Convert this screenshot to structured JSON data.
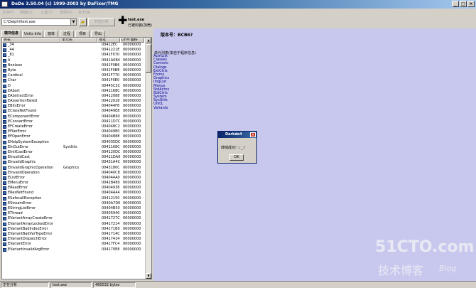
{
  "window": {
    "title": "DeDe 3.50.04 (c) 1999-2003 by DaFixer/TMG"
  },
  "titlebar_buttons": [
    "_",
    "□",
    "×"
  ],
  "menu": [
    "文件(F)",
    "转储(D)",
    "工具(T)",
    "选项(O)",
    "关于(A)"
  ],
  "toolbar": {
    "file_path": "C:\\Delphi\\test.exe",
    "combo_arrow": "▼",
    "open_icon": "folder-icon",
    "start_button": "开始分析",
    "file_name": "test.exe",
    "file_subtitle": "已被封装(加壳)"
  },
  "tabs": [
    "模块信息",
    "Units Info",
    "窗体",
    "过程",
    "项目",
    "导出"
  ],
  "columns": [
    "类名",
    "单元名",
    "地址",
    "DFM 偏移"
  ],
  "rows": [
    {
      "name": "_34",
      "unit": "",
      "addr": "00412EC",
      "dfm": "00000000"
    },
    {
      "name": "_44",
      "unit": "",
      "addr": "0041221E",
      "dfm": "00000000"
    },
    {
      "name": "_81",
      "unit": "",
      "addr": "0041F070",
      "dfm": "00000000"
    },
    {
      "name": "A",
      "unit": "",
      "addr": "0041A0B4",
      "dfm": "00000000"
    },
    {
      "name": "Boolean",
      "unit": "",
      "addr": "0041F0B6",
      "dfm": "00000000"
    },
    {
      "name": "Byte",
      "unit": "",
      "addr": "0041F0BE",
      "dfm": "00000000"
    },
    {
      "name": "Cardinal",
      "unit": "",
      "addr": "0041F770",
      "dfm": "00000000"
    },
    {
      "name": "Char",
      "unit": "",
      "addr": "0041F0E0",
      "dfm": "00000000"
    },
    {
      "name": "D",
      "unit": "",
      "addr": "00445C3C",
      "dfm": "00000000"
    },
    {
      "name": "EAbort",
      "unit": "",
      "addr": "0041168C",
      "dfm": "00000000"
    },
    {
      "name": "EAbstractError",
      "unit": "",
      "addr": "00412088",
      "dfm": "00000000"
    },
    {
      "name": "EAssertionFailed",
      "unit": "",
      "addr": "00412028",
      "dfm": "00000000"
    },
    {
      "name": "EBitsError",
      "unit": "",
      "addr": "004044F8",
      "dfm": "00000000"
    },
    {
      "name": "EClassNotFound",
      "unit": "",
      "addr": "004049E8",
      "dfm": "00000000"
    },
    {
      "name": "EComponentError",
      "unit": "",
      "addr": "00404B60",
      "dfm": "00000000"
    },
    {
      "name": "EConvertError",
      "unit": "",
      "addr": "00411D7C",
      "dfm": "00000000"
    },
    {
      "name": "EFCreateError",
      "unit": "",
      "addr": "004048C2",
      "dfm": "00000000"
    },
    {
      "name": "EFilerError",
      "unit": "",
      "addr": "004049E0",
      "dfm": "00000000"
    },
    {
      "name": "EFOpenError",
      "unit": "",
      "addr": "00404888",
      "dfm": "00000000"
    },
    {
      "name": "EHelpSystemException",
      "unit": "",
      "addr": "004035DC",
      "dfm": "00000000"
    },
    {
      "name": "EInOutError",
      "unit": "SysUtils",
      "addr": "0041168C",
      "dfm": "00000000"
    },
    {
      "name": "EIntfCastError",
      "unit": "",
      "addr": "004120DC",
      "dfm": "00000000"
    },
    {
      "name": "EInvalidCast",
      "unit": "",
      "addr": "00411DA0",
      "dfm": "00000000"
    },
    {
      "name": "EInvalidGraphic",
      "unit": "",
      "addr": "00431A4C",
      "dfm": "00000000"
    },
    {
      "name": "EInvalidGraphicOperation",
      "unit": "Graphics",
      "addr": "0043180C",
      "dfm": "00000000"
    },
    {
      "name": "EInvalidOperation",
      "unit": "",
      "addr": "004040C8",
      "dfm": "00000000"
    },
    {
      "name": "EListError",
      "unit": "",
      "addr": "004044A0",
      "dfm": "00000000"
    },
    {
      "name": "EMenuError",
      "unit": "",
      "addr": "0042B480",
      "dfm": "00000000"
    },
    {
      "name": "EReadError",
      "unit": "",
      "addr": "00404938",
      "dfm": "00000000"
    },
    {
      "name": "EResNotFound",
      "unit": "",
      "addr": "00404A44",
      "dfm": "00000000"
    },
    {
      "name": "ESafecallException",
      "unit": "",
      "addr": "00412150",
      "dfm": "00000000"
    },
    {
      "name": "EStreamError",
      "unit": "",
      "addr": "0040A7D0",
      "dfm": "00000000"
    },
    {
      "name": "EStringListError",
      "unit": "",
      "addr": "00404B50",
      "dfm": "00000000"
    },
    {
      "name": "EThread",
      "unit": "",
      "addr": "00405940",
      "dfm": "00000000"
    },
    {
      "name": "EVariantArrayCreateError",
      "unit": "",
      "addr": "0041727C",
      "dfm": "00000000"
    },
    {
      "name": "EVariantArrayLockedError",
      "unit": "",
      "addr": "00417214",
      "dfm": "00000000"
    },
    {
      "name": "EVariantBadIndexError",
      "unit": "",
      "addr": "004171B0",
      "dfm": "00000000"
    },
    {
      "name": "EVariantBadVarTypeError",
      "unit": "",
      "addr": "0041714C",
      "dfm": "00000000"
    },
    {
      "name": "EVariantDispatchError",
      "unit": "",
      "addr": "00417414",
      "dfm": "00000000"
    },
    {
      "name": "EVariantError",
      "unit": "",
      "addr": "00417FC4",
      "dfm": "00000000"
    },
    {
      "name": "EVariantInvalidArgError",
      "unit": "",
      "addr": "004170E8",
      "dfm": "00000000"
    }
  ],
  "right_panel": {
    "version": "版本号：BCB6?",
    "unit_list_label": "单元列表(来自于程序信息)",
    "units": [
      "ActnList",
      "Classes",
      "Controls",
      "Dialogs",
      "ExtCtrls",
      "Forms",
      "Graphics",
      "ImgList",
      "Menus",
      "StdActns",
      "StdCtrls",
      "System",
      "SysUtils",
      "Unit1",
      "Variants"
    ]
  },
  "dialog": {
    "title": "Darkde4",
    "close": "×",
    "message": "转储成功! ☆_☆",
    "ok": "OK"
  },
  "status": {
    "left": "正在分析",
    "file": "test.exe",
    "size": "480032 bytes"
  },
  "watermark": {
    "site": "51CTO.com",
    "tagline": "技术博客",
    "blog": "Blog"
  },
  "colors": {
    "title_gradient_start": "#0a246a",
    "right_panel_bg": "#c8c8ee",
    "unit_text": "#00008b"
  }
}
